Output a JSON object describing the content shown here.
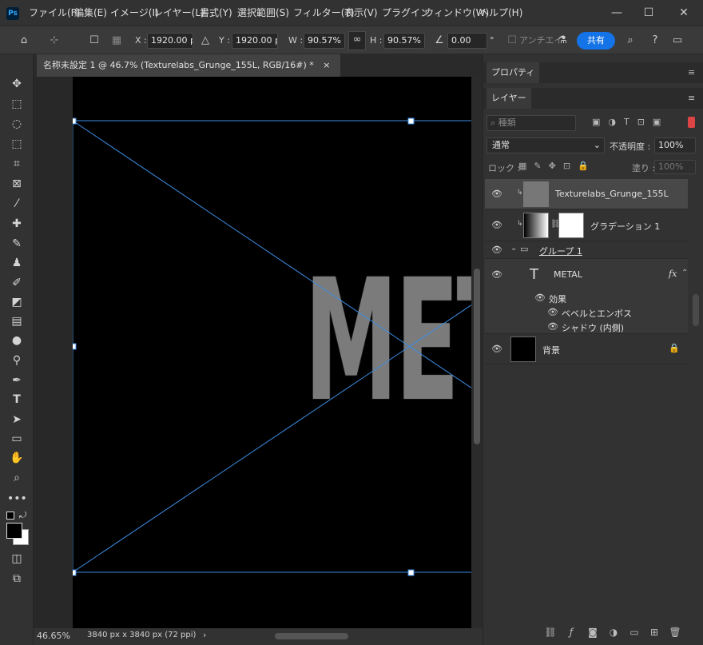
{
  "menubar": {
    "app_logo": "Ps",
    "items": [
      "ファイル(F)",
      "編集(E)",
      "イメージ(I)",
      "レイヤー(L)",
      "書式(Y)",
      "選択範囲(S)",
      "フィルター(T)",
      "表示(V)",
      "プラグイン",
      "ウィンドウ(W)",
      "ヘルプ(H)"
    ],
    "window_controls": {
      "minimize": "—",
      "maximize": "☐",
      "close": "✕"
    }
  },
  "options": {
    "x_label": "X :",
    "x_value": "1920.00 px",
    "y_label": "Y :",
    "y_value": "1920.00 px",
    "w_label": "W :",
    "w_value": "90.57%",
    "h_label": "H :",
    "h_value": "90.57%",
    "angle_value": "0.00",
    "angle_unit": "°",
    "antialias_label": "アンチエイ",
    "share_label": "共有"
  },
  "document": {
    "tab_title": "名称未設定 1 @ 46.7% (Texturelabs_Grunge_155L, RGB/16#) *",
    "tab_close": "×",
    "canvas_text": "METAL"
  },
  "status": {
    "zoom": "46.65%",
    "dimensions": "3840 px x 3840 px (72 ppi)"
  },
  "panels": {
    "properties_tab": "プロパティ",
    "layers_tab": "レイヤー",
    "search_placeholder": "種類",
    "blend_mode": "通常",
    "opacity_label": "不透明度 :",
    "opacity_value": "100%",
    "lock_label": "ロック :",
    "fill_label": "塗り :",
    "fill_value": "100%"
  },
  "layers": {
    "l1": "Texturelabs_Grunge_155L",
    "l2": "グラデーション 1",
    "group": "グループ 1",
    "metal": "METAL",
    "effects": "効果",
    "bevel": "ベベルとエンボス",
    "shadow": "シャドウ (内側)",
    "background": "背景",
    "fx": "fx"
  },
  "colors": {
    "accent": "#1473e6",
    "transform_line": "#3d8ee6"
  }
}
